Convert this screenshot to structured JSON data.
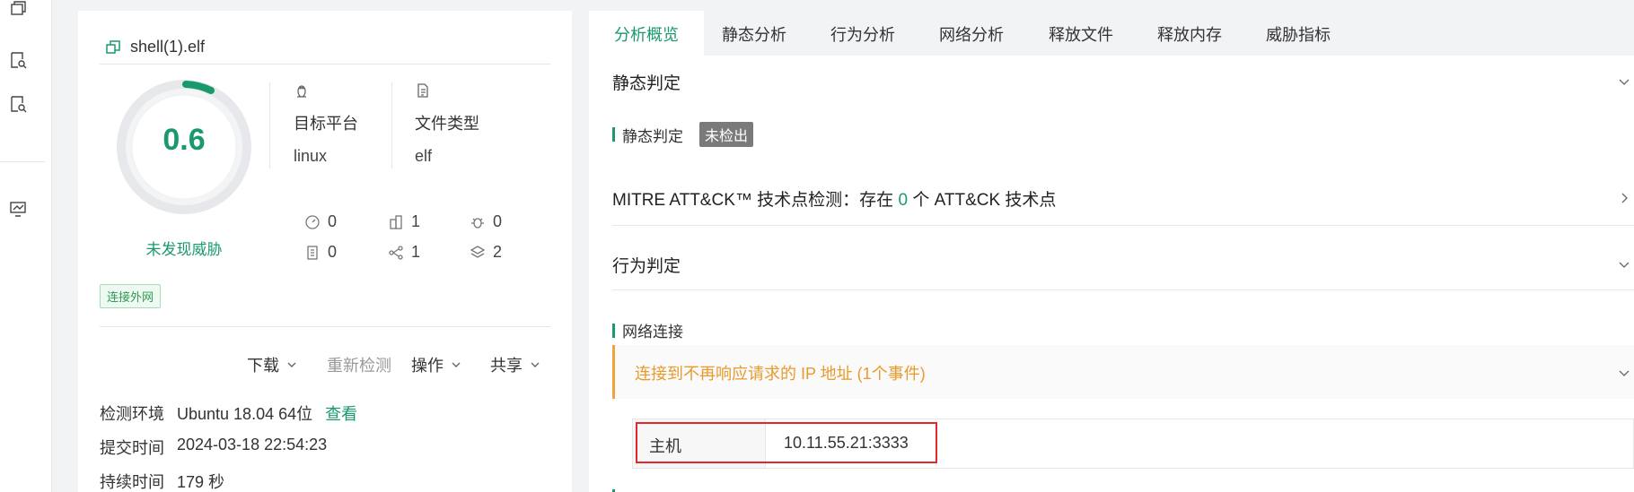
{
  "rail": {
    "icons": [
      "window-stack-icon",
      "doc-search-icon",
      "doc-search-icon",
      "monitor-chart-icon"
    ]
  },
  "file": {
    "name": "shell(1).elf",
    "score": "0.6",
    "verdict": "未发现威胁",
    "platform_label": "目标平台",
    "platform_value": "linux",
    "filetype_label": "文件类型",
    "filetype_value": "elf",
    "stats": {
      "gauge": "0",
      "building": "1",
      "bug": "0",
      "doc": "0",
      "share": "1",
      "layers": "2"
    },
    "tag": "连接外网"
  },
  "actions": {
    "download": "下载",
    "redetect": "重新检测",
    "operate": "操作",
    "share": "共享"
  },
  "meta": {
    "env_label": "检测环境",
    "env_value": "Ubuntu 18.04 64位",
    "env_link": "查看",
    "submit_label": "提交时间",
    "submit_value": "2024-03-18 22:54:23",
    "duration_label": "持续时间",
    "duration_value": "179 秒"
  },
  "tabs": [
    "分析概览",
    "静态分析",
    "行为分析",
    "网络分析",
    "释放文件",
    "释放内存",
    "威胁指标"
  ],
  "static": {
    "title": "静态判定",
    "sub_label": "静态判定",
    "badge": "未检出"
  },
  "mitre": {
    "prefix": "MITRE ATT&CK™ 技术点检测：存在",
    "count": "0",
    "suffix": "个 ATT&CK 技术点"
  },
  "behavior": {
    "title": "行为判定"
  },
  "network": {
    "title": "网络连接",
    "alert": "连接到不再响应请求的 IP 地址 (1个事件)",
    "host_label": "主机",
    "host_value": "10.11.55.21:3333"
  },
  "colors": {
    "accent": "#1a9a6c",
    "warning": "#f0a33a",
    "highlight": "#e0292c"
  }
}
